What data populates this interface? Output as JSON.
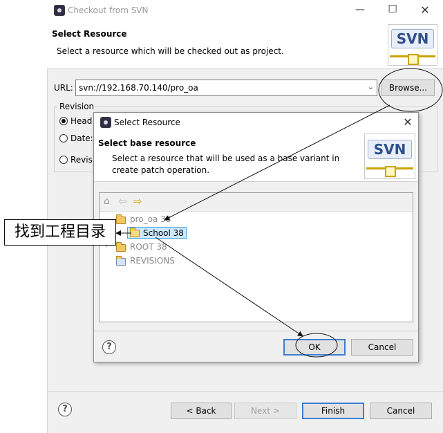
{
  "outer": {
    "title": "Checkout from SVN",
    "header_title": "Select Resource",
    "header_desc": "Select a resource which will be checked out as project.",
    "logo_text": "SVN",
    "url_label": "URL:",
    "url_value": "svn://192.168.70.140/pro_oa",
    "browse_label": "Browse...",
    "revision_group": "Revision",
    "radio_head": "Head",
    "radio_date": "Date:",
    "radio_revision": "Revisi",
    "help": "?",
    "back_label": "< Back",
    "next_label": "Next >",
    "finish_label": "Finish",
    "cancel_label": "Cancel"
  },
  "inner": {
    "title": "Select Resource",
    "header_title": "Select base resource",
    "header_desc_line1": "Select a resource that will be used as a base variant in",
    "header_desc_line2": "create patch operation.",
    "logo_text": "SVN",
    "tree": [
      {
        "label": "pro_oa 38",
        "state": "expanded",
        "icon": "folder-icon"
      },
      {
        "label": "School 38",
        "state": "selected",
        "icon": "open-folder-icon"
      },
      {
        "label": "ROOT 38",
        "state": "collapsed",
        "icon": "folder-icon"
      },
      {
        "label": "REVISIONS",
        "state": "leaf",
        "icon": "revisions-icon"
      }
    ],
    "help": "?",
    "ok_label": "OK",
    "cancel_label": "Cancel"
  },
  "annotation": {
    "text": "找到工程目录"
  },
  "colors": {
    "accent": "#3c7fd0",
    "selection": "#cce8ff"
  }
}
